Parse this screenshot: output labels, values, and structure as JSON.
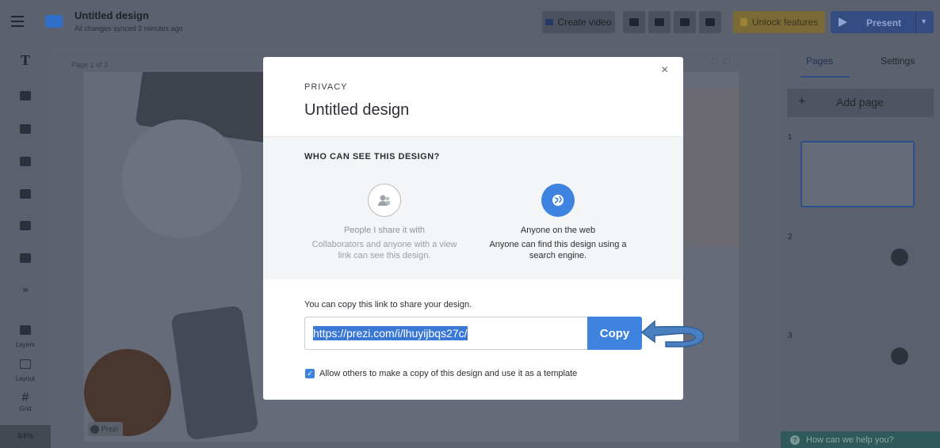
{
  "header": {
    "title": "Untitled design",
    "sync_status": "All changes synced 3 minutes ago",
    "create_video_label": "Create video",
    "unlock_label": "Unlock features",
    "present_label": "Present"
  },
  "left_toolbar": {
    "text_tool": "T",
    "layers_label": "Layers",
    "layout_label": "Layout",
    "grid_label": "Grid",
    "zoom": "64%"
  },
  "canvas": {
    "page_label": "Page 1 of 3",
    "badge": "Prezi"
  },
  "right_panel": {
    "tabs": [
      "Pages",
      "Settings"
    ],
    "add_page_label": "Add page",
    "page_numbers": [
      "1",
      "2",
      "3"
    ],
    "help_label": "How can we help you?"
  },
  "modal": {
    "eyebrow": "PRIVACY",
    "title": "Untitled design",
    "close": "×",
    "question": "WHO CAN SEE THIS DESIGN?",
    "options": [
      {
        "name": "People I share it with",
        "description": "Collaborators and anyone with a view link can see this design.",
        "icon": "people-icon",
        "selected": false
      },
      {
        "name": "Anyone on the web",
        "description": "Anyone can find this design using a search engine.",
        "icon": "globe-icon",
        "selected": true
      }
    ],
    "link_label": "You can copy this link to share your design.",
    "link_url": "https://prezi.com/i/lhuyijbqs27c/",
    "copy_label": "Copy",
    "template_checkbox_label": "Allow others to make a copy of this design and use it as a template",
    "template_checked": true
  },
  "colors": {
    "accent": "#3e83e0",
    "overlay": "#5b616d",
    "present": "#344c82",
    "arrow": "#4a7fc0"
  }
}
